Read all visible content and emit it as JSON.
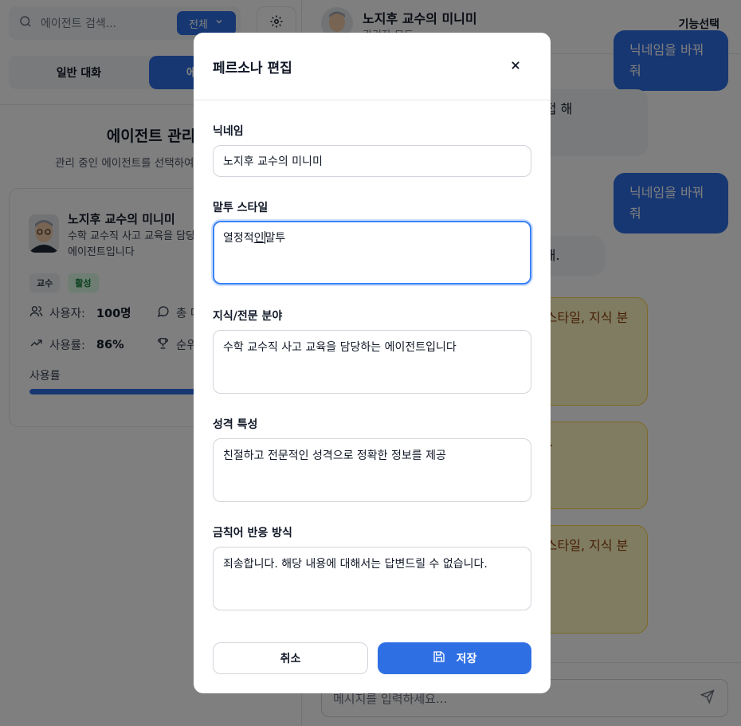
{
  "left": {
    "search": {
      "placeholder": "에이전트 검색...",
      "filter_label": "전체"
    },
    "tabs": [
      {
        "label": "일반 대화"
      },
      {
        "label": "에이전트 관리"
      }
    ],
    "management": {
      "title": "에이전트 관리",
      "subtitle": "관리 중인 에이전트를 선택하여 편집하세요"
    },
    "agent_card": {
      "name": "노지후 교수의 미니미",
      "description": "수학 교수직 사고 교육을 담당하는 에이전트입니다",
      "badges": [
        "교수",
        "활성"
      ],
      "stats": [
        {
          "icon": "users-icon",
          "label": "사용자:",
          "value": "100명"
        },
        {
          "icon": "message-icon",
          "label": "총 메시지:",
          "value": ""
        },
        {
          "icon": "trending-up-icon",
          "label": "사용률:",
          "value": "86%"
        },
        {
          "icon": "trophy-icon",
          "label": "순위:",
          "value": ""
        }
      ],
      "usage_label": "사용률",
      "usage_fraction": 0.86
    }
  },
  "chat": {
    "header": {
      "name": "노지후 교수의 미니미",
      "role": "관리자 모드",
      "function_label": "기능선택"
    },
    "messages": [
      {
        "type": "user",
        "text": "닉네임을 바꿔줘"
      },
      {
        "type": "bot",
        "text": "닉네임은 편집 화면에서 바꿔. 직접 해"
      },
      {
        "type": "user",
        "text": "닉네임을 바꿔줘"
      },
      {
        "type": "bot",
        "text": "직접 바꿔야 해."
      },
      {
        "type": "notice",
        "text": "페르소나 편집에서 닉네임, 말투 스타일, 지식 분야를 수정할 수 있습"
      },
      {
        "type": "notice",
        "text": "에이전트 말투덜이 스머프 입니다."
      },
      {
        "type": "notice",
        "text": "페르소나 편집에서 닉네임, 말투 스타일, 지식 분야를 수정할 수 있습"
      }
    ],
    "composer": {
      "placeholder": "메시지를 입력하세요..."
    }
  },
  "modal": {
    "title": "페르소나 편집",
    "fields": {
      "nickname": {
        "label": "닉네임",
        "value": "노지후 교수의 미니미"
      },
      "tone": {
        "label": "말투 스타일",
        "value_before": "열정적",
        "value_composing": "인",
        "value_after": "말투"
      },
      "knowledge": {
        "label": "지식/전문 분야",
        "value": "수학 교수직 사고 교육을 담당하는 에이전트입니다"
      },
      "personality": {
        "label": "성격 특성",
        "value": "친절하고 전문적인 성격으로 정확한 정보를 제공"
      },
      "forbidden": {
        "label": "금칙어 반응 방식",
        "value": "죄송합니다. 해당 내용에 대해서는 답변드릴 수 없습니다."
      }
    },
    "cancel_label": "취소",
    "save_label": "저장"
  },
  "colors": {
    "primary": "#2f6fe4",
    "overlay": "rgba(0,0,0,0.5)",
    "notice_bg": "#fef9c3",
    "notice_border": "#fcd34d",
    "success": "#15803d"
  }
}
